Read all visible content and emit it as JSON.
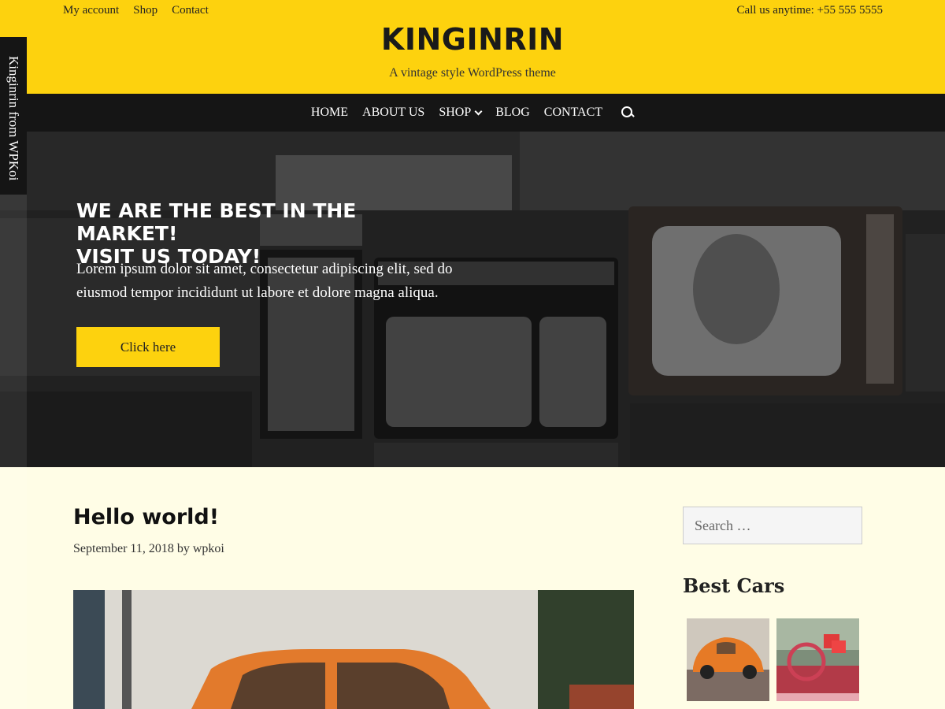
{
  "topbar": {
    "links": [
      "My account",
      "Shop",
      "Contact"
    ],
    "callus": "Call us anytime: +55 555 5555"
  },
  "site": {
    "title": "KINGINRIN",
    "description": "A vintage style WordPress theme"
  },
  "nav": {
    "items": [
      "HOME",
      "ABOUT US",
      "SHOP",
      "BLOG",
      "CONTACT"
    ],
    "search_icon": "search-icon"
  },
  "sidetab": {
    "label": "Kinginrin from WPKoi"
  },
  "hero": {
    "title_line1": "WE ARE THE BEST IN THE MARKET!",
    "title_line2": "VISIT US TODAY!",
    "text": "Lorem ipsum dolor sit amet, consectetur adipiscing elit, sed do eiusmod tempor incididunt ut labore et dolore magna aliqua.",
    "button": "Click here"
  },
  "post": {
    "title": "Hello world!",
    "date": "September 11, 2018",
    "by": "by",
    "author": "wpkoi"
  },
  "sidebar": {
    "search_placeholder": "Search …",
    "widget_title": "Best Cars"
  },
  "colors": {
    "accent": "#fdd20e",
    "dark": "#151515",
    "background": "#fffde6"
  }
}
